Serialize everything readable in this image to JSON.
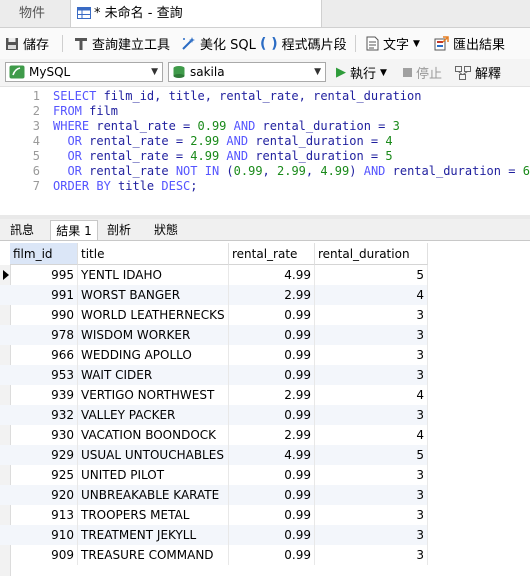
{
  "tabs": {
    "objects": "物件",
    "query": "* 未命名 - 查詢"
  },
  "toolbar": {
    "save": "儲存",
    "query_builder": "查詢建立工具",
    "beautify": "美化 SQL",
    "snippet": "程式碼片段",
    "text": "文字",
    "export": "匯出結果"
  },
  "connection": {
    "server": "MySQL",
    "database": "sakila",
    "run": "執行",
    "stop": "停止",
    "explain": "解釋"
  },
  "editor": {
    "line_numbers": [
      "1",
      "2",
      "3",
      "4",
      "5",
      "6",
      "7"
    ]
  },
  "result_tabs": [
    "訊息",
    "結果 1",
    "剖析",
    "狀態"
  ],
  "grid": {
    "columns": [
      "film_id",
      "title",
      "rental_rate",
      "rental_duration"
    ],
    "rows": [
      [
        "995",
        "YENTL IDAHO",
        "4.99",
        "5"
      ],
      [
        "991",
        "WORST BANGER",
        "2.99",
        "4"
      ],
      [
        "990",
        "WORLD LEATHERNECKS",
        "0.99",
        "3"
      ],
      [
        "978",
        "WISDOM WORKER",
        "0.99",
        "3"
      ],
      [
        "966",
        "WEDDING APOLLO",
        "0.99",
        "3"
      ],
      [
        "953",
        "WAIT CIDER",
        "0.99",
        "3"
      ],
      [
        "939",
        "VERTIGO NORTHWEST",
        "2.99",
        "4"
      ],
      [
        "932",
        "VALLEY PACKER",
        "0.99",
        "3"
      ],
      [
        "930",
        "VACATION BOONDOCK",
        "2.99",
        "4"
      ],
      [
        "929",
        "USUAL UNTOUCHABLES",
        "4.99",
        "5"
      ],
      [
        "925",
        "UNITED PILOT",
        "0.99",
        "3"
      ],
      [
        "920",
        "UNBREAKABLE KARATE",
        "0.99",
        "3"
      ],
      [
        "913",
        "TROOPERS METAL",
        "0.99",
        "3"
      ],
      [
        "910",
        "TREATMENT JEKYLL",
        "0.99",
        "3"
      ],
      [
        "909",
        "TREASURE COMMAND",
        "0.99",
        "3"
      ]
    ]
  },
  "colors": {
    "accent": "#2e7d32",
    "keyword": "#5555ff",
    "number": "#1a8a1a",
    "header_selected": "#dbe6f7"
  }
}
